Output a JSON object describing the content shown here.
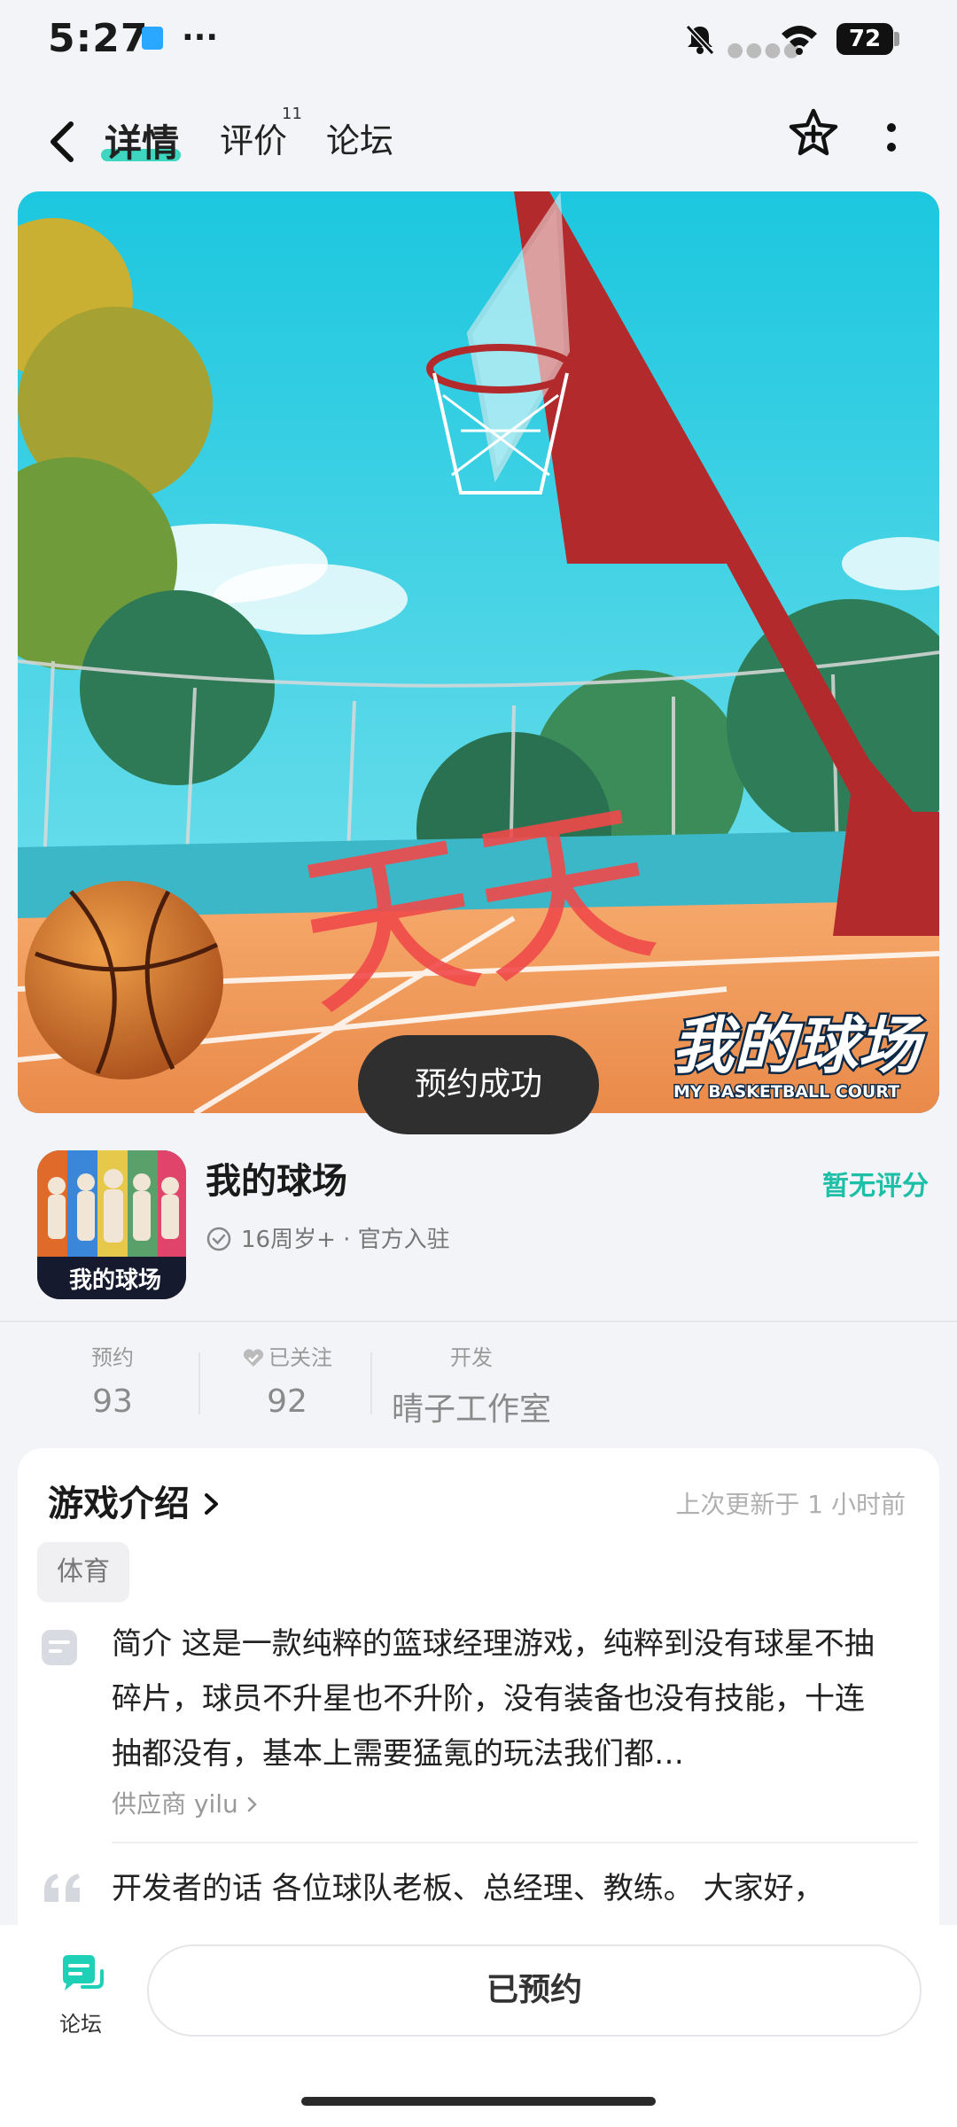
{
  "status_bar": {
    "time": "5:27",
    "battery": "72"
  },
  "nav": {
    "tabs": [
      {
        "label": "详情",
        "active": true
      },
      {
        "label": "评价",
        "badge": "11"
      },
      {
        "label": "论坛"
      }
    ]
  },
  "banner": {
    "overlay_text": "天天",
    "logo_main": "我的球场",
    "logo_sub": "MY BASKETBALL COURT"
  },
  "toast": {
    "text": "预约成功"
  },
  "game": {
    "name": "我的球场",
    "meta": "16周岁+ · 官方入驻",
    "rating": "暂无评分",
    "icon_caption": "我的球场"
  },
  "stats": [
    {
      "label": "预约",
      "value": "93"
    },
    {
      "label": "已关注",
      "value": "92"
    },
    {
      "label": "开发",
      "value": "晴子工作室"
    }
  ],
  "intro": {
    "title": "游戏介绍",
    "updated": "上次更新于 1 小时前",
    "tag": "体育",
    "description": "简介 这是一款纯粹的篮球经理游戏，纯粹到没有球星不抽碎片，球员不升星也不升阶，没有装备也没有技能，十连抽都没有，基本上需要猛氪的玩法我们都…",
    "supplier": "供应商 yilu",
    "developer_words": "开发者的话 各位球队老板、总经理、教练。 大家好，"
  },
  "bottom": {
    "forum_label": "论坛",
    "reserved_label": "已预约"
  },
  "colors": {
    "accent": "#1dd0b6",
    "toast_bg": "#2f2f2f"
  }
}
